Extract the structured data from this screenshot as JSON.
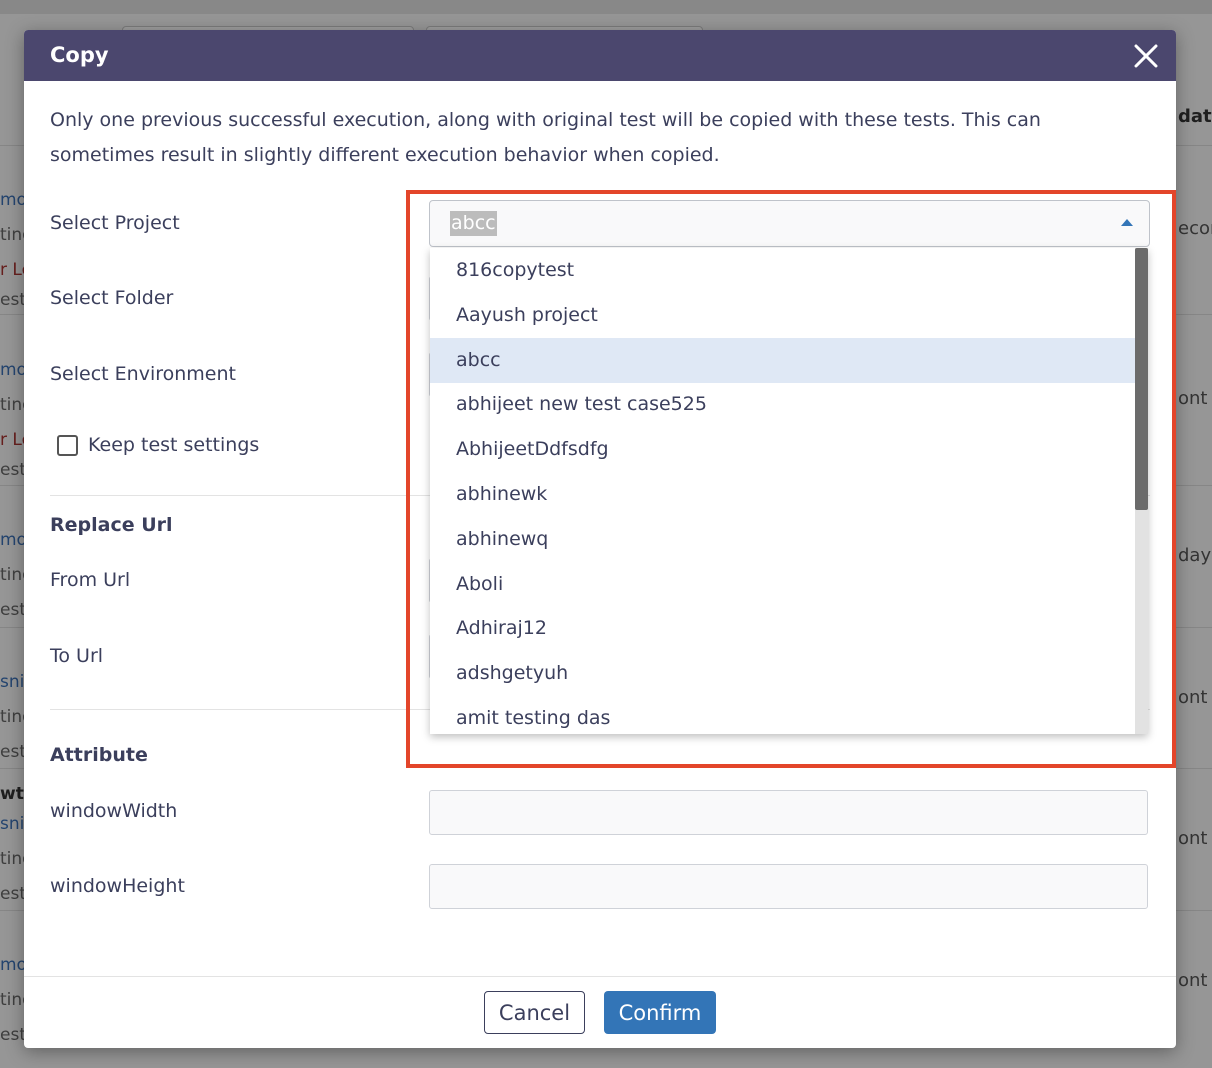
{
  "background": {
    "left_fragments": [
      {
        "text": "mo",
        "cls": "blue"
      },
      {
        "text": "ting",
        "cls": "grey"
      },
      {
        "text": "r Le",
        "cls": "red"
      },
      {
        "text": "est",
        "cls": "grey"
      },
      {
        "text": "mo",
        "cls": "blue"
      },
      {
        "text": "ting",
        "cls": "grey"
      },
      {
        "text": "r Le",
        "cls": "red"
      },
      {
        "text": "est",
        "cls": "grey"
      },
      {
        "text": "mo",
        "cls": "blue"
      },
      {
        "text": "ting",
        "cls": "grey"
      },
      {
        "text": "est",
        "cls": "grey"
      },
      {
        "text": "sni",
        "cls": "blue"
      },
      {
        "text": "ting",
        "cls": "grey"
      },
      {
        "text": "est",
        "cls": "grey"
      },
      {
        "text": "wte",
        "cls": "bold"
      },
      {
        "text": "sni",
        "cls": "blue"
      },
      {
        "text": "ting",
        "cls": "grey"
      },
      {
        "text": "est",
        "cls": "grey"
      },
      {
        "text": "mo",
        "cls": "blue"
      },
      {
        "text": "ting",
        "cls": "grey"
      },
      {
        "text": "est",
        "cls": "grey"
      }
    ],
    "right_fragments": [
      "date",
      "econ",
      "ont",
      "days",
      "ont",
      "ont",
      "ont"
    ]
  },
  "modal": {
    "title": "Copy",
    "description": "Only one previous successful execution, along with original test will be copied with these tests. This can sometimes result in slightly different execution behavior when copied.",
    "labels": {
      "select_project": "Select Project",
      "select_folder": "Select Folder",
      "select_environment": "Select Environment",
      "keep_test_settings": "Keep test settings",
      "replace_url": "Replace Url",
      "from_url": "From Url",
      "to_url": "To Url",
      "attribute": "Attribute",
      "window_width": "windowWidth",
      "window_height": "windowHeight"
    },
    "select_project_value": "abcc",
    "keep_test_settings_checked": false,
    "window_width_value": "",
    "window_height_value": "",
    "project_options": [
      "816copytest",
      "Aayush project",
      "abcc",
      "abhijeet new test case525",
      "AbhijeetDdfsdfg",
      "abhinewk",
      "abhinewq",
      "Aboli",
      "Adhiraj12",
      "adshgetyuh",
      "amit testing das"
    ],
    "selected_option": "abcc",
    "buttons": {
      "cancel": "Cancel",
      "confirm": "Confirm"
    }
  },
  "colors": {
    "header": "#4b476e",
    "primary": "#3375b7",
    "highlight": "#e3452a",
    "selected_option_bg": "#dfe8f5"
  },
  "icons": {
    "close": "close-icon",
    "caret": "caret-up-icon",
    "checkbox": "checkbox-icon"
  }
}
